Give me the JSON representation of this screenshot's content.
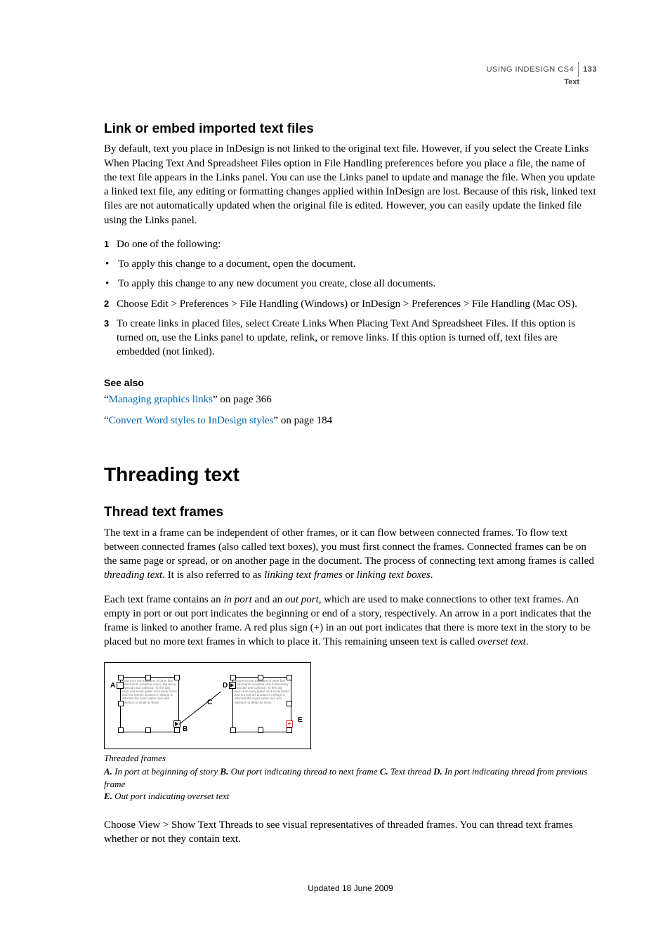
{
  "header": {
    "using": "USING INDESIGN CS4",
    "pagenum": "133",
    "section": "Text"
  },
  "sec1": {
    "title": "Link or embed imported text files",
    "para": "By default, text you place in InDesign is not linked to the original text file. However, if you select the Create Links When Placing Text And Spreadsheet Files option in File Handling preferences before you place a file, the name of the text file appears in the Links panel. You can use the Links panel to update and manage the file. When you update a linked text file, any editing or formatting changes applied within InDesign are lost. Because of this risk, linked text files are not automatically updated when the original file is edited. However, you can easily update the linked file using the Links panel."
  },
  "steps": {
    "s1": {
      "n": "1",
      "t": "Do one of the following:"
    },
    "b1": {
      "t": "To apply this change to a document, open the document."
    },
    "b2": {
      "t": "To apply this change to any new document you create, close all documents."
    },
    "s2": {
      "n": "2",
      "t": "Choose Edit > Preferences > File Handling (Windows) or InDesign > Preferences > File Handling (Mac OS)."
    },
    "s3": {
      "n": "3",
      "t": "To create links in placed files, select Create Links When Placing Text And Spreadsheet Files. If this option is turned on, use the Links panel to update, relink, or remove links. If this option is turned off, text files are embedded (not linked)."
    }
  },
  "seealso": {
    "heading": "See also",
    "l1_pre": "“",
    "l1_link": "Managing graphics links",
    "l1_post": "” on page 366",
    "l2_pre": "“",
    "l2_link": "Convert Word styles to InDesign styles",
    "l2_post": "” on page 184"
  },
  "h1": "Threading text",
  "sec2": {
    "title": "Thread text frames",
    "p1a": "The text in a frame can be independent of other frames, or it can flow between connected frames. To flow text between connected frames (also called text boxes), you must first connect the frames. Connected frames can be on the same page or spread, or on another page in the document. The process of connecting text among frames is called ",
    "p1b": "threading text",
    "p1c": ". It is also referred to as ",
    "p1d": "linking text frames",
    "p1e": " or ",
    "p1f": "linking text boxes",
    "p1g": ".",
    "p2a": "Each text frame contains an ",
    "p2b": "in port",
    "p2c": " and an ",
    "p2d": "out port",
    "p2e": ", which are used to make connections to other text frames. An empty in port or out port indicates the beginning or end of a story, respectively. An arrow in a port indicates that the frame is linked to another frame. A red plus sign (+) in an out port indicates that there is more text in the story to be placed but no more text frames in which to place it. This remaining unseen text is called ",
    "p2f": "overset text",
    "p2g": "."
  },
  "figure": {
    "caption": "Threaded frames",
    "kA": "A.",
    "dA": " In port at beginning of story  ",
    "kB": "B.",
    "dB": " Out port indicating thread to next frame  ",
    "kC": "C.",
    "dC": " Text thread  ",
    "kD": "D.",
    "dD": " In port indicating thread from previous frame  ",
    "kE": "E.",
    "dE": " Out port indicating overset text",
    "lA": "A",
    "lB": "B",
    "lC": "C",
    "lD": "D",
    "lE": "E",
    "greek": "grow from the traditions of other fine instruments available only to the many musician and collector. To this day each and every guitar neck body frame and nut scenes produce in design is afforded the exact same care and attention to detail as those",
    "plus": "+"
  },
  "p3": "Choose View > Show Text Threads to see visual representatives of threaded frames. You can thread text frames whether or not they contain text.",
  "footer": "Updated 18 June 2009"
}
